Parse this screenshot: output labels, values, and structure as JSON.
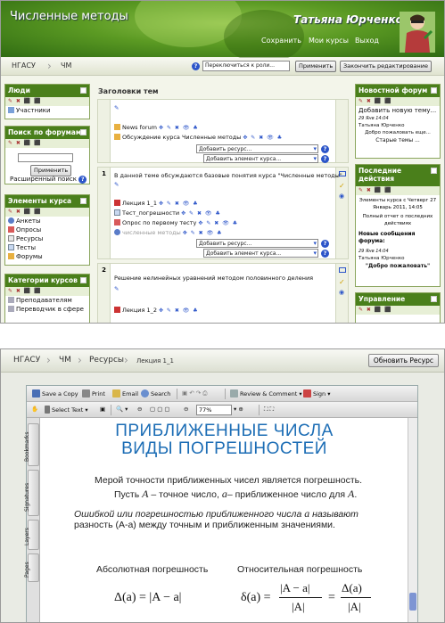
{
  "moodle": {
    "site_title": "Численные методы",
    "user_name": "Татьяна Юрченко",
    "nav": [
      "Сохранить",
      "Мои курсы",
      "Выход"
    ],
    "breadcrumbs": [
      "НГАСУ",
      "ЧМ"
    ],
    "switch_role": "Переключиться к роли...",
    "apply_label": "Применить",
    "finish_edit_label": "Закончить редактирование",
    "help": "?",
    "tool_icons": "✎ ✖ ⬛ ⬛",
    "blocks": {
      "people": {
        "title": "Люди",
        "items": [
          "Участники"
        ]
      },
      "forum_search": {
        "title": "Поиск по форумам",
        "button": "Применить",
        "advanced": "Расширенный поиск"
      },
      "course_elements": {
        "title": "Элементы курса",
        "items": [
          "Анкеты",
          "Опросы",
          "Ресурсы",
          "Тесты",
          "Форумы"
        ]
      },
      "course_categories": {
        "title": "Категории курсов",
        "items": [
          "Преподавателям",
          "Переводчик в сфере"
        ]
      },
      "news": {
        "title": "Новостной форум",
        "add_topic": "Добавить новую тему...",
        "date": "29 Янв 14:04",
        "author": "Татьяна Юрченко",
        "text": "Добро пожаловать еще...",
        "old": "Старые темы ..."
      },
      "recent": {
        "title": "Последние действия",
        "since": "Элементы курса с Четверг 27 Январь 2011, 14:05",
        "full_report": "Полный отчет о последних действиях",
        "new_posts": "Новые сообщения форума:",
        "date": "29 Янв 14:04",
        "author": "Татьяна Юрченко",
        "post": "\"Добро пожаловать\""
      },
      "admin": {
        "title": "Управление"
      }
    },
    "topics_header": "Заголовки тем",
    "edit_glyph": "✎",
    "edit_icons": "✥ ✎ ✖ 👁 ♣",
    "add_resource": "Добавить ресурс...",
    "add_element": "Добавить элемент курса...",
    "section0": {
      "items": [
        "News forum",
        "Обсуждение курса Численные методы"
      ]
    },
    "section1": {
      "number": "1",
      "summary": "В данной теме обсуждаются базовые понятия курса \"Численные методы\"",
      "items": [
        "Лекция 1_1",
        "Тест_погрешности",
        "Опрос по первому тесту",
        "численные методы"
      ]
    },
    "section2": {
      "number": "2",
      "summary": "Решение нелинейных уравнений методом половинного деления",
      "items": [
        "Лекция 1_2"
      ]
    }
  },
  "pdf": {
    "breadcrumbs": [
      "НГАСУ",
      "ЧМ",
      "Ресурсы"
    ],
    "doc_name": "Лекция 1_1",
    "reload_label": "Обновить Ресурс",
    "toolbar": {
      "save_copy": "Save a Copy",
      "print": "Print",
      "email": "Email",
      "search": "Search",
      "review": "Review & Comment",
      "sign": "Sign",
      "select_text": "Select Text",
      "zoom": "77%"
    },
    "side_tabs": [
      "Bookmarks",
      "Signatures",
      "Layers",
      "Pages"
    ],
    "page": {
      "title1": "ПРИБЛИЖЕННЫЕ ЧИСЛА",
      "title2": "ВИДЫ ПОГРЕШНОСТЕЙ",
      "line1": "Мерой точности приближенных чисел является погрешность.",
      "line2a": "Пусть",
      "var_A": "A",
      "line2b": " – точное число, ",
      "var_a": "a",
      "line2c": "– приближенное число для ",
      "line2d": ".",
      "line3": "Ошибкой или погрешностью приближенного числа",
      "line3var": "a",
      "line3end": "называют",
      "line4": "разность (A-a) между точным и приближенным значениями.",
      "abs_label": "Абсолютная погрешность",
      "rel_label": "Относительная погрешность",
      "abs_formula": "Δ(a) = |A − a|",
      "rel_lhs": "δ(a) =",
      "rel_num1": "|A − a|",
      "rel_den": "|A|",
      "rel_eq": "=",
      "rel_num2": "Δ(a)"
    }
  }
}
